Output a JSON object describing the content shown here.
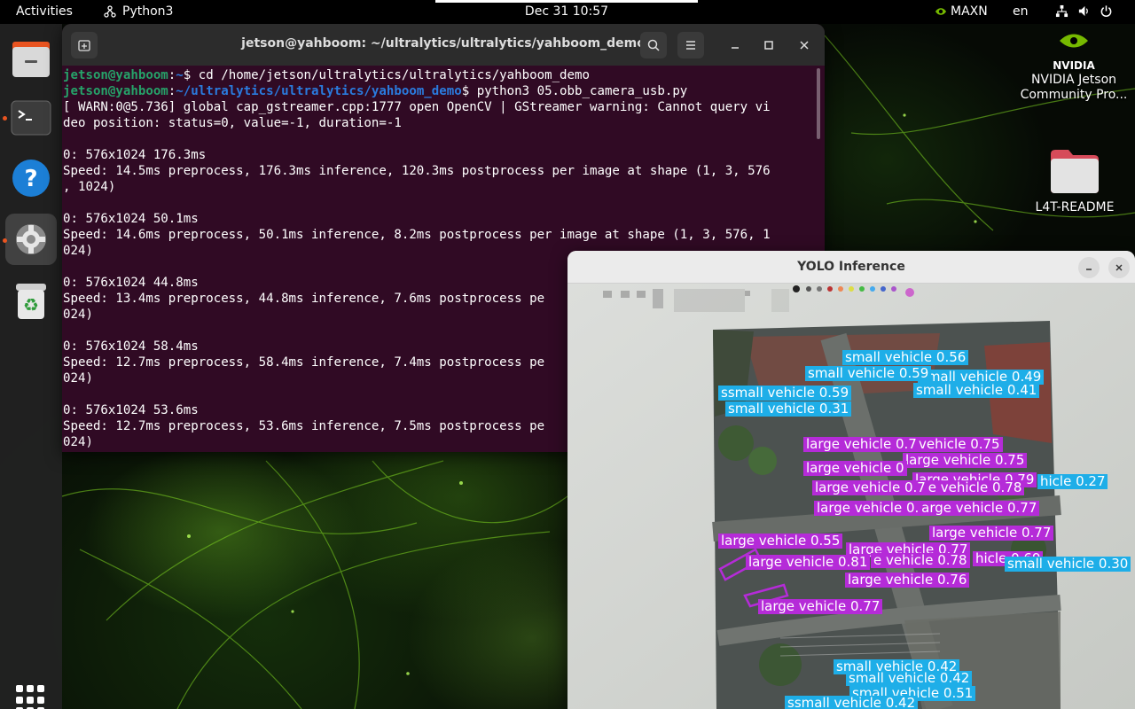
{
  "topbar": {
    "activities": "Activities",
    "app_name": "Python3",
    "clock": "Dec 31  10:57",
    "power_mode": "MAXN",
    "language": "en"
  },
  "desktop": {
    "nvidia_label": "NVIDIA Jetson Community Pro...",
    "folder_label": "L4T-README"
  },
  "terminal": {
    "title": "jetson@yahboom: ~/ultralytics/ultralytics/yahboom_demo",
    "lines": [
      {
        "user": "jetson@yahboom",
        "path": "~",
        "cmd": "$ cd /home/jetson/ultralytics/ultralytics/yahboom_demo"
      },
      {
        "user": "jetson@yahboom",
        "path": "~/ultralytics/ultralytics/yahboom_demo",
        "cmd": "$ python3 05.obb_camera_usb.py"
      },
      {
        "text": "[ WARN:0@5.736] global cap_gstreamer.cpp:1777 open OpenCV | GStreamer warning: Cannot query vi"
      },
      {
        "text": "deo position: status=0, value=-1, duration=-1"
      },
      {
        "text": ""
      },
      {
        "text": "0: 576x1024 176.3ms"
      },
      {
        "text": "Speed: 14.5ms preprocess, 176.3ms inference, 120.3ms postprocess per image at shape (1, 3, 576"
      },
      {
        "text": ", 1024)"
      },
      {
        "text": ""
      },
      {
        "text": "0: 576x1024 50.1ms"
      },
      {
        "text": "Speed: 14.6ms preprocess, 50.1ms inference, 8.2ms postprocess per image at shape (1, 3, 576, 1"
      },
      {
        "text": "024)"
      },
      {
        "text": ""
      },
      {
        "text": "0: 576x1024 44.8ms"
      },
      {
        "text": "Speed: 13.4ms preprocess, 44.8ms inference, 7.6ms postprocess pe"
      },
      {
        "text": "024)"
      },
      {
        "text": ""
      },
      {
        "text": "0: 576x1024 58.4ms"
      },
      {
        "text": "Speed: 12.7ms preprocess, 58.4ms inference, 7.4ms postprocess pe"
      },
      {
        "text": "024)"
      },
      {
        "text": ""
      },
      {
        "text": "0: 576x1024 53.6ms"
      },
      {
        "text": "Speed: 12.7ms preprocess, 53.6ms inference, 7.5ms postprocess pe"
      },
      {
        "text": "024)"
      }
    ]
  },
  "yolo_window": {
    "title": "YOLO Inference",
    "detections": [
      {
        "cls": "small",
        "label": "small vehicle 0.56"
      },
      {
        "cls": "small",
        "label": "small vehicle 0.49"
      },
      {
        "cls": "small",
        "label": "small vehicle 0.59"
      },
      {
        "cls": "small",
        "label": "small vehicle 0.41"
      },
      {
        "cls": "small",
        "label": "ssmall vehicle 0.59"
      },
      {
        "cls": "small",
        "label": "small vehicle 0.31"
      },
      {
        "cls": "large",
        "label": "large vehicle 0.79"
      },
      {
        "cls": "large",
        "label": "vehicle 0.75"
      },
      {
        "cls": "large",
        "label": "large vehicle 0.75"
      },
      {
        "cls": "large",
        "label": "large vehicle 0"
      },
      {
        "cls": "large",
        "label": "large vehicle 0.79"
      },
      {
        "cls": "small",
        "label": "hicle 0.27"
      },
      {
        "cls": "large",
        "label": "large vehicle 0.78"
      },
      {
        "cls": "large",
        "label": "large vehicle 0.7"
      },
      {
        "cls": "large",
        "label": "large vehicle 0.77"
      },
      {
        "cls": "large",
        "label": "large vehicle 0."
      },
      {
        "cls": "large",
        "label": "large vehicle 0.77"
      },
      {
        "cls": "large",
        "label": "large vehicle 0.55"
      },
      {
        "cls": "large",
        "label": "large vehicle 0.77"
      },
      {
        "cls": "large",
        "label": "large vehicle 0.81"
      },
      {
        "cls": "large",
        "label": "e vehicle 0.78"
      },
      {
        "cls": "large",
        "label": "hicle 0.69"
      },
      {
        "cls": "small",
        "label": "small vehicle 0.30"
      },
      {
        "cls": "large",
        "label": "large vehicle 0.76"
      },
      {
        "cls": "large",
        "label": "large vehicle 0.77"
      },
      {
        "cls": "small",
        "label": "small vehicle 0.42"
      },
      {
        "cls": "small",
        "label": "small vehicle 0.42"
      },
      {
        "cls": "small",
        "label": "small vehicle 0.51"
      },
      {
        "cls": "small",
        "label": "ssmall vehicle 0.42"
      }
    ]
  },
  "colors": {
    "small_vehicle": "#1eaee8",
    "large_vehicle": "#b52bd8",
    "terminal_bg": "#300a24",
    "prompt_user": "#26a269",
    "prompt_path": "#2a7bde",
    "ubuntu_orange": "#e95420"
  }
}
